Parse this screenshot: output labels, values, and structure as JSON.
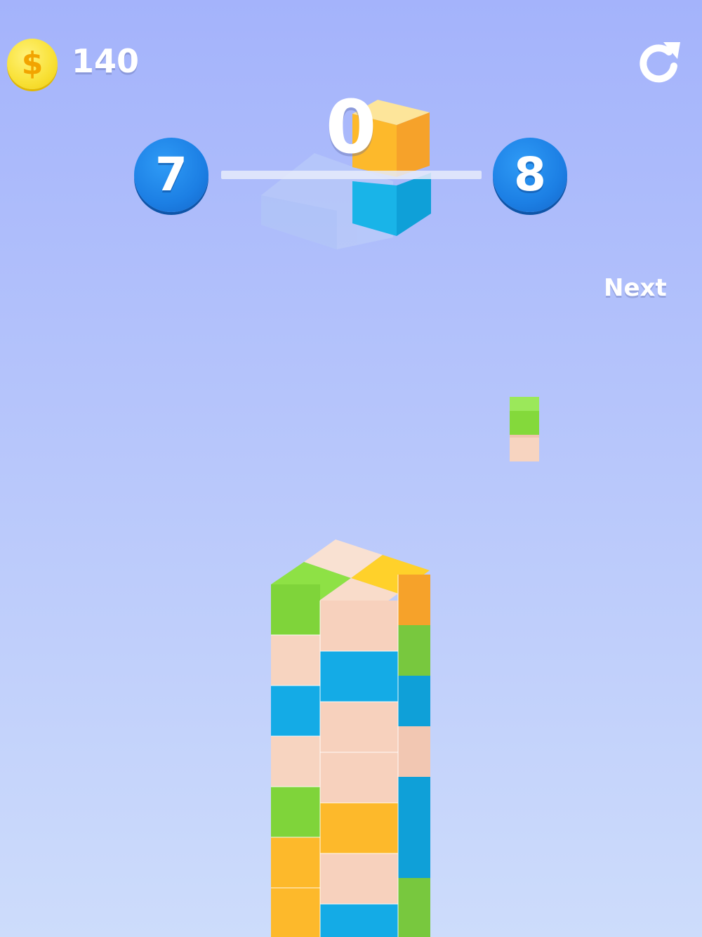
{
  "hud": {
    "coin_symbol": "$",
    "coins": "140",
    "score": "0",
    "restart_icon": "restart-icon"
  },
  "level": {
    "current": "7",
    "next": "8",
    "progress": 0
  },
  "next_piece": {
    "label": "Next",
    "colors": [
      "green",
      "peach"
    ]
  },
  "colors": {
    "green": "#84d93b",
    "peach": "#f7d4c0",
    "blue": "#14abe6",
    "orange": "#fdb92b",
    "level_blue": "#1c7fe4",
    "coin_gold": "#f9e23a"
  }
}
